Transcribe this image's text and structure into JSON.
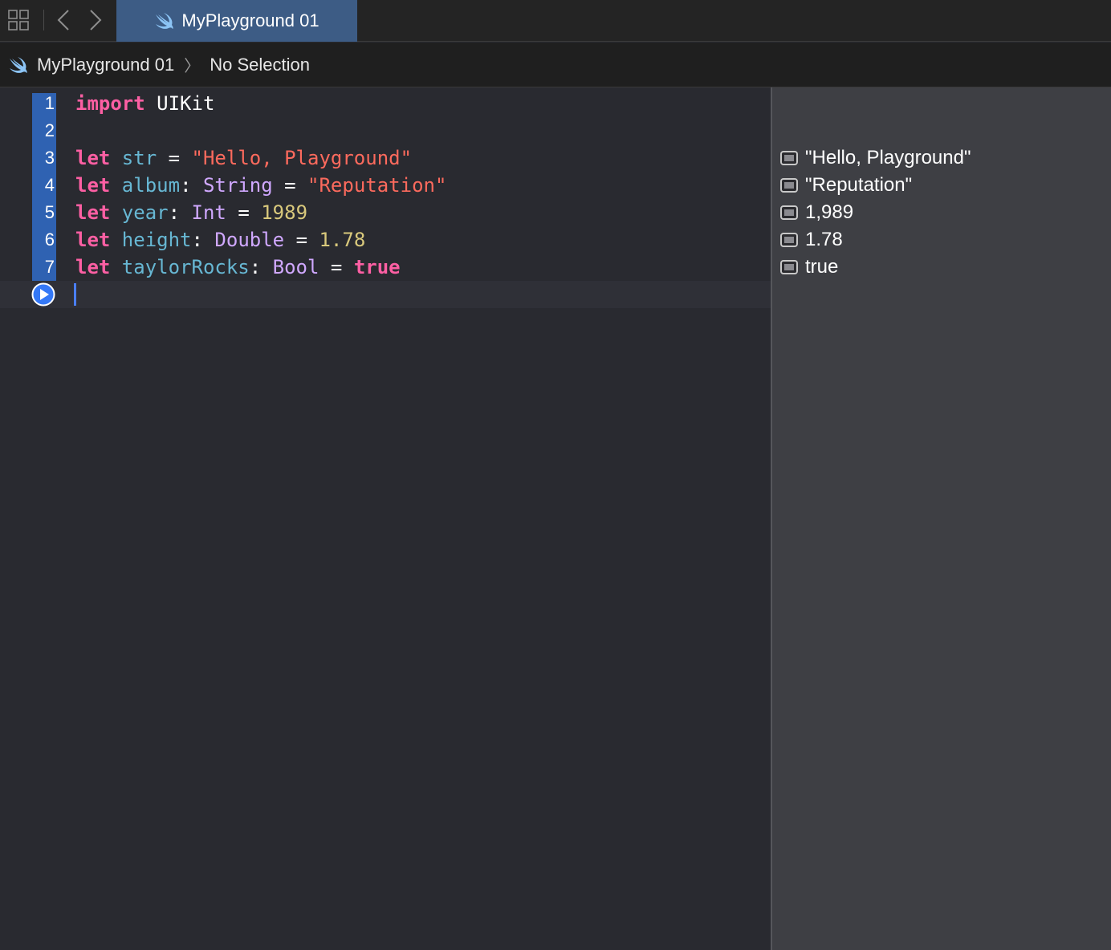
{
  "tabs": {
    "active_label": "MyPlayground 01"
  },
  "jumpbar": {
    "file": "MyPlayground 01",
    "chevron": "〉",
    "selection": "No Selection"
  },
  "editor": {
    "line_numbers": [
      "1",
      "2",
      "3",
      "4",
      "5",
      "6",
      "7"
    ],
    "lines": [
      [
        {
          "t": "import",
          "c": "kw"
        },
        {
          "t": " UIKit",
          "c": "plain"
        }
      ],
      [],
      [
        {
          "t": "let",
          "c": "kw"
        },
        {
          "t": " str",
          "c": "var"
        },
        {
          "t": " = ",
          "c": "plain"
        },
        {
          "t": "\"Hello, Playground\"",
          "c": "str"
        }
      ],
      [
        {
          "t": "let",
          "c": "kw"
        },
        {
          "t": " album",
          "c": "var"
        },
        {
          "t": ": ",
          "c": "plain"
        },
        {
          "t": "String",
          "c": "typ"
        },
        {
          "t": " = ",
          "c": "plain"
        },
        {
          "t": "\"Reputation\"",
          "c": "str"
        }
      ],
      [
        {
          "t": "let",
          "c": "kw"
        },
        {
          "t": " year",
          "c": "var"
        },
        {
          "t": ": ",
          "c": "plain"
        },
        {
          "t": "Int",
          "c": "typ"
        },
        {
          "t": " = ",
          "c": "plain"
        },
        {
          "t": "1989",
          "c": "num"
        }
      ],
      [
        {
          "t": "let",
          "c": "kw"
        },
        {
          "t": " height",
          "c": "var"
        },
        {
          "t": ": ",
          "c": "plain"
        },
        {
          "t": "Double",
          "c": "typ"
        },
        {
          "t": " = ",
          "c": "plain"
        },
        {
          "t": "1.78",
          "c": "num"
        }
      ],
      [
        {
          "t": "let",
          "c": "kw"
        },
        {
          "t": " taylorRocks",
          "c": "var"
        },
        {
          "t": ": ",
          "c": "plain"
        },
        {
          "t": "Bool",
          "c": "typ"
        },
        {
          "t": " = ",
          "c": "plain"
        },
        {
          "t": "true",
          "c": "kw"
        }
      ]
    ]
  },
  "results": [
    {
      "line": 3,
      "value": "\"Hello, Playground\""
    },
    {
      "line": 4,
      "value": "\"Reputation\""
    },
    {
      "line": 5,
      "value": "1,989"
    },
    {
      "line": 6,
      "value": "1.78"
    },
    {
      "line": 7,
      "value": "true"
    }
  ],
  "colors": {
    "keyword": "#fc5fa3",
    "variable": "#67b7d3",
    "type": "#d0a8ff",
    "string": "#fc6a5d",
    "number": "#d9c97c",
    "gutter_highlight": "#2f62b2",
    "active_tab": "#3d5c85"
  },
  "icons": [
    "grid-icon",
    "back-chevron-icon",
    "forward-chevron-icon",
    "swift-icon",
    "run-icon",
    "quick-look-icon"
  ]
}
